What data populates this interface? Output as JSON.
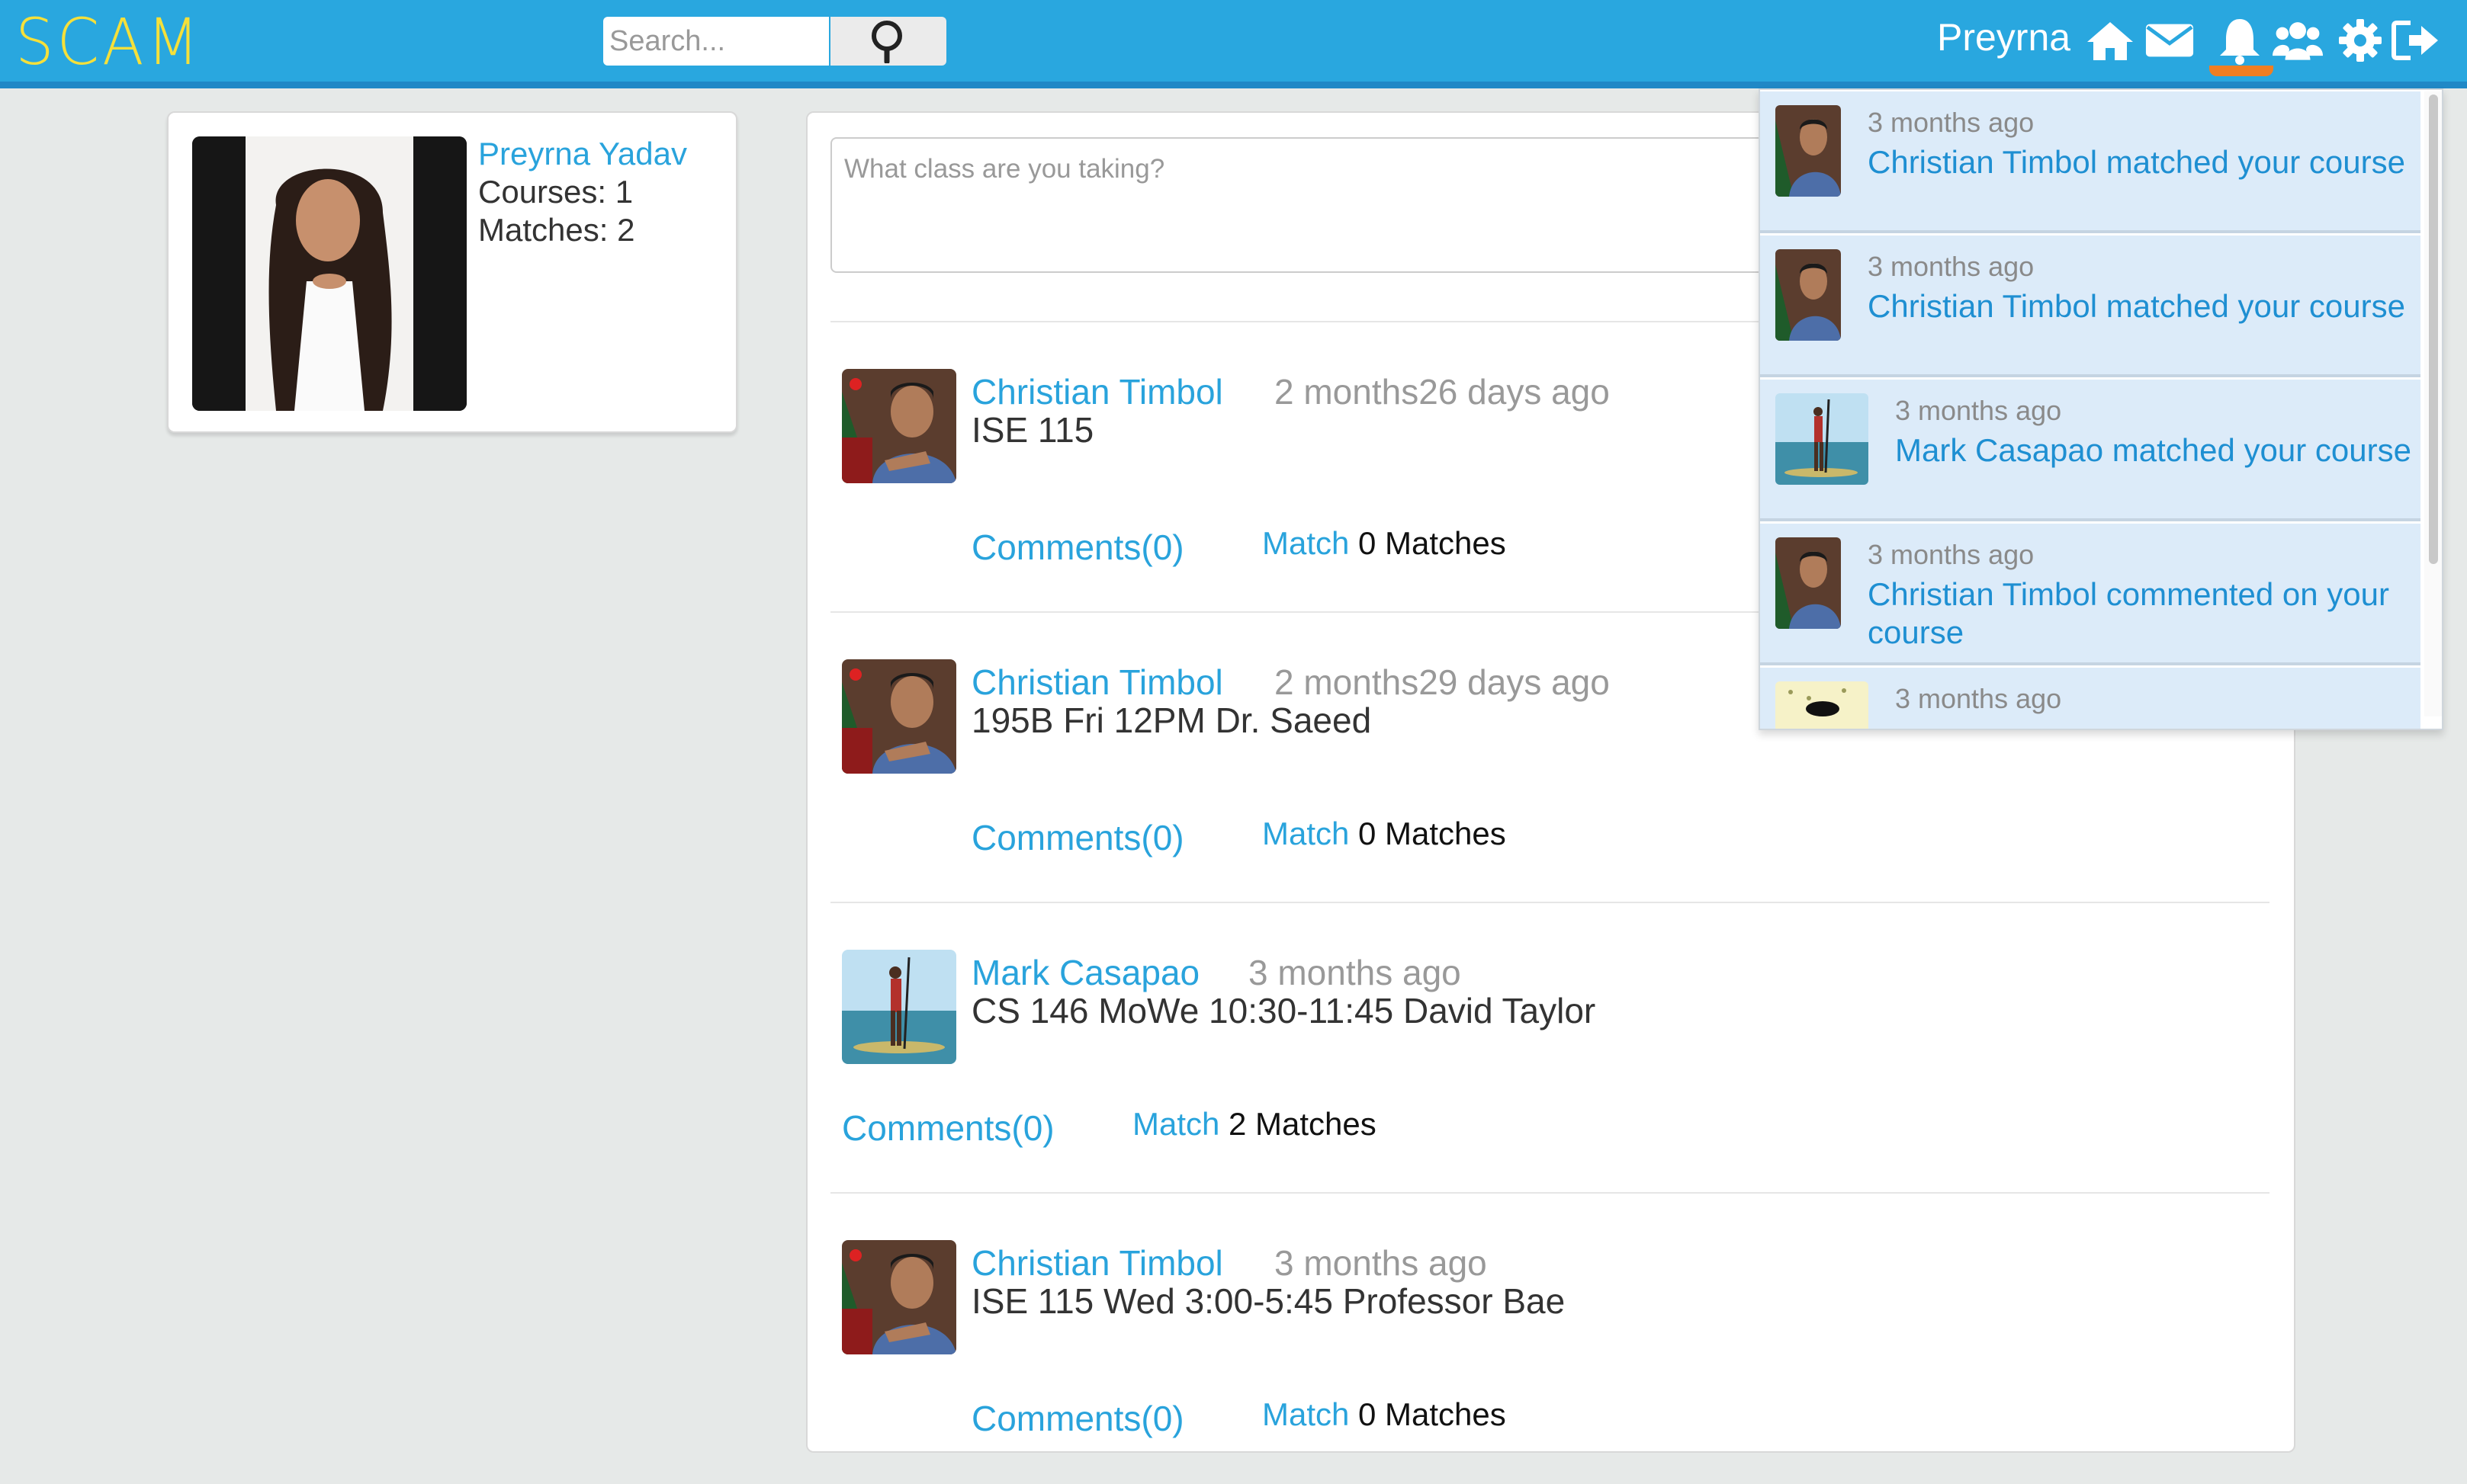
{
  "header": {
    "logo": "SCAM",
    "search_placeholder": "Search...",
    "username": "Preyrna",
    "icons": [
      "home-icon",
      "envelope-icon",
      "bell-icon",
      "users-icon",
      "gear-icon",
      "sign-out-icon"
    ],
    "colors": {
      "bar": "#29a7df",
      "logo": "#f5e03a",
      "active": "#f07e22"
    }
  },
  "profile": {
    "name": "Preyrna Yadav",
    "courses": "Courses: 1",
    "matches": "Matches: 2"
  },
  "composer": {
    "placeholder": "What class are you taking?"
  },
  "posts": [
    {
      "author": "Christian Timbol",
      "time": "2 months26 days ago",
      "course": "ISE 115",
      "comments": "Comments(0)",
      "match_label": "Match",
      "match_count": "0 Matches"
    },
    {
      "author": "Christian Timbol",
      "time": "2 months29 days ago",
      "course": "195B Fri 12PM Dr. Saeed",
      "comments": "Comments(0)",
      "match_label": "Match",
      "match_count": "0 Matches"
    },
    {
      "author": "Mark Casapao",
      "time": "3 months ago",
      "course": "CS 146 MoWe 10:30-11:45 David Taylor",
      "comments": "Comments(0)",
      "match_label": "Match",
      "match_count": "2 Matches"
    },
    {
      "author": "Christian Timbol",
      "time": "3 months ago",
      "course": "ISE 115 Wed 3:00-5:45 Professor Bae",
      "comments": "Comments(0)",
      "match_label": "Match",
      "match_count": "0 Matches"
    }
  ],
  "notifications": [
    {
      "time": "3 months ago",
      "text": "Christian Timbol matched your course"
    },
    {
      "time": "3 months ago",
      "text": "Christian Timbol matched your course"
    },
    {
      "time": "3 months ago",
      "text": "Mark Casapao matched your course"
    },
    {
      "time": "3 months ago",
      "text": "Christian Timbol commented on your course"
    },
    {
      "time": "3 months ago",
      "text": ""
    }
  ]
}
